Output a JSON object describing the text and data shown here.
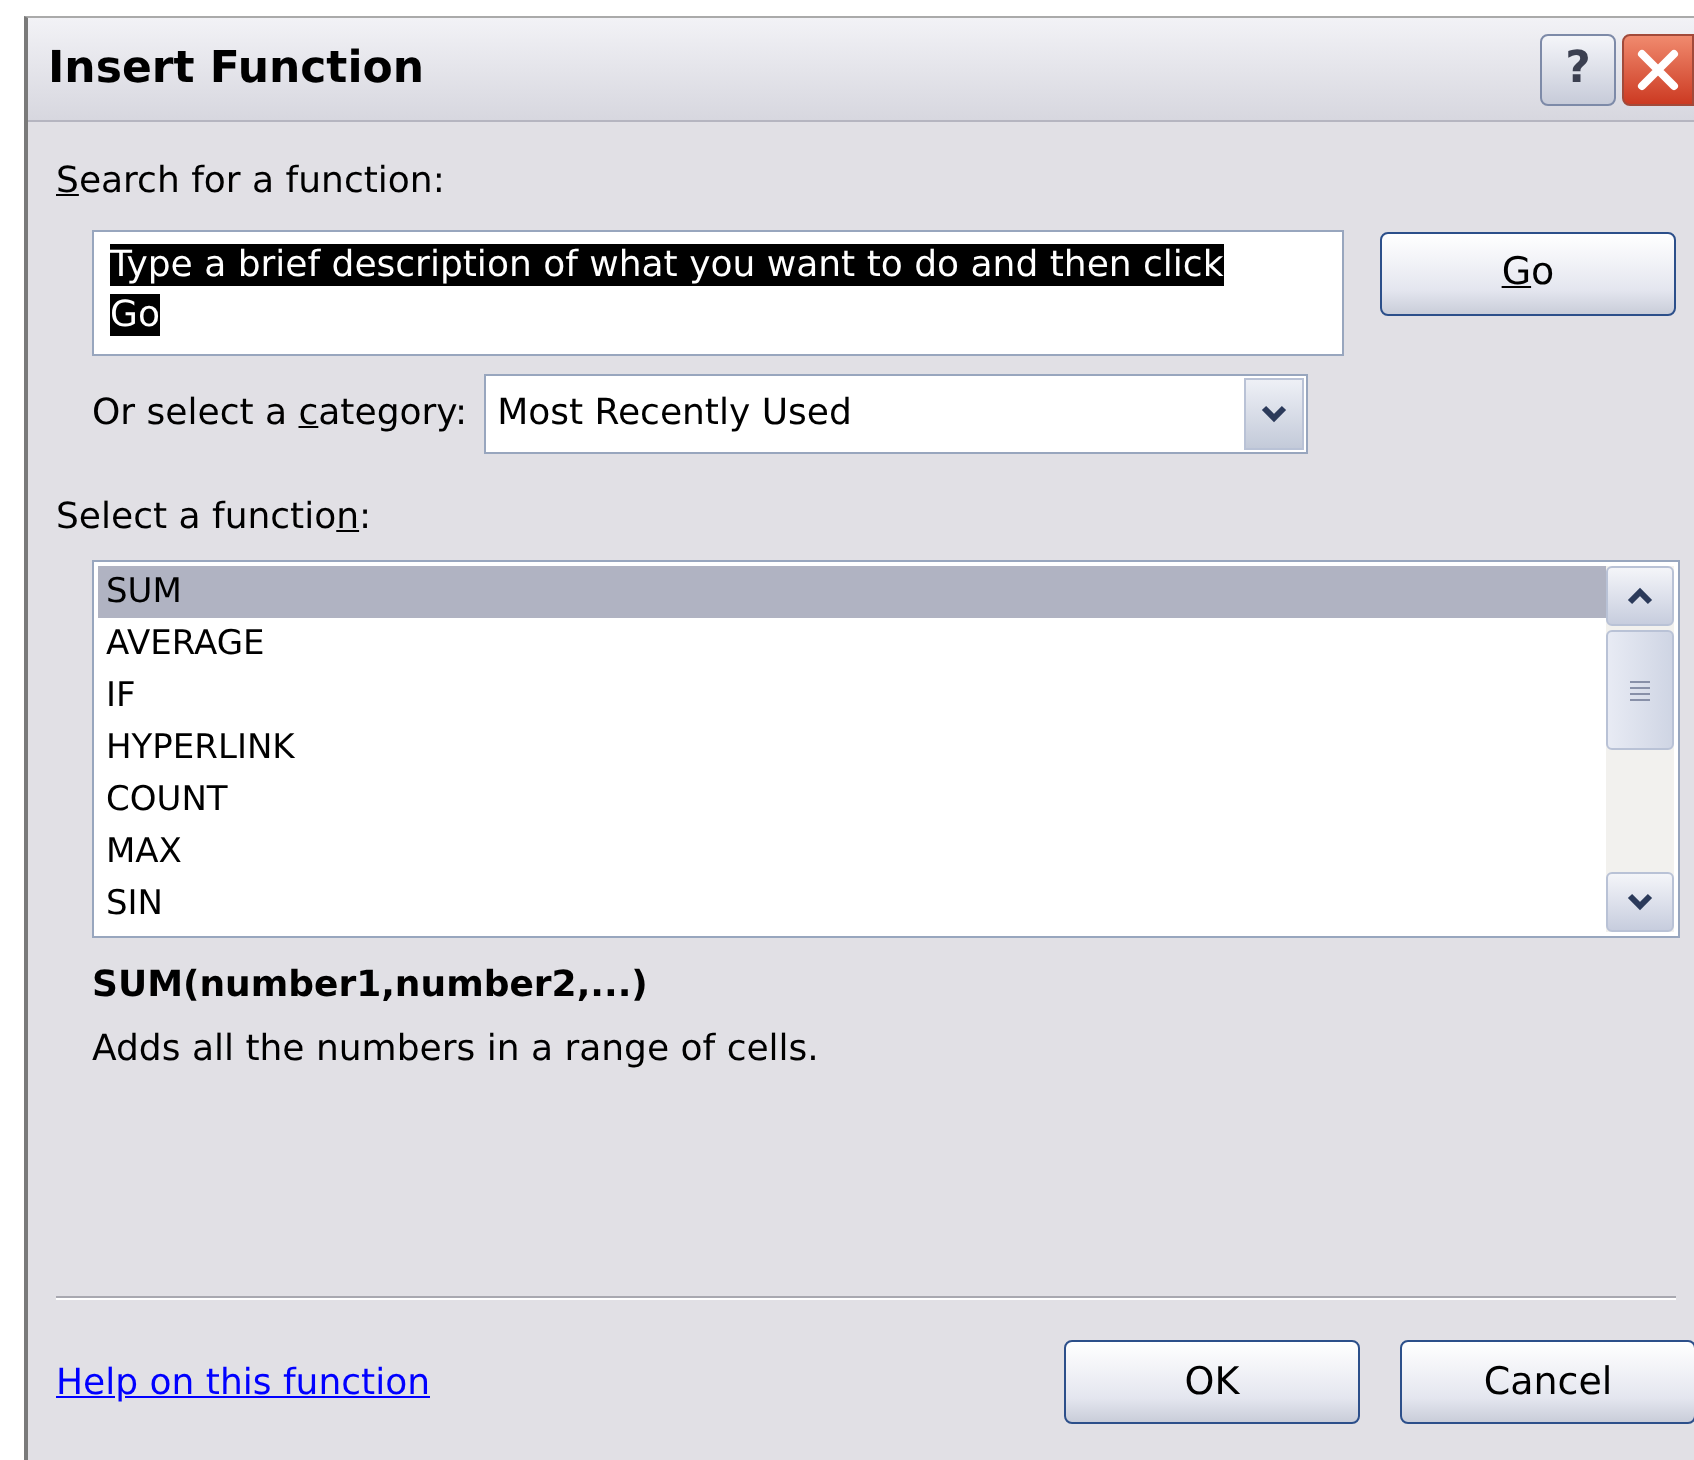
{
  "window": {
    "title": "Insert Function",
    "help_button": "?"
  },
  "search": {
    "label": {
      "key": "S",
      "after": "earch for a function:"
    },
    "value": "Type a brief description of what you want to do and then click Go",
    "text_selected": true,
    "button": {
      "label": {
        "key": "G",
        "after": "o"
      }
    }
  },
  "category": {
    "label": {
      "before": "Or select a ",
      "key": "c",
      "after": "ategory:"
    },
    "value": "Most Recently Used"
  },
  "function_list": {
    "label": {
      "before": "Select a functio",
      "key": "n",
      "after": ":"
    },
    "items": [
      {
        "name": "SUM",
        "selected": true
      },
      {
        "name": "AVERAGE",
        "selected": false
      },
      {
        "name": "IF",
        "selected": false
      },
      {
        "name": "HYPERLINK",
        "selected": false
      },
      {
        "name": "COUNT",
        "selected": false
      },
      {
        "name": "MAX",
        "selected": false
      },
      {
        "name": "SIN",
        "selected": false
      }
    ]
  },
  "signature": "SUM(number1,number2,...)",
  "description": "Adds all the numbers in a range of cells.",
  "help_link": "Help on this function",
  "buttons": [
    {
      "label": "OK"
    },
    {
      "label": "Cancel"
    }
  ]
}
